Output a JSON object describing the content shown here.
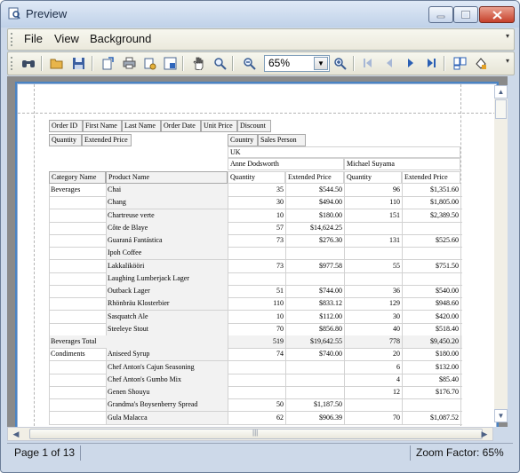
{
  "window": {
    "title": "Preview"
  },
  "menu": {
    "file": "File",
    "view": "View",
    "background": "Background"
  },
  "toolbar": {
    "zoom_value": "65%"
  },
  "statusbar": {
    "page": "Page 1 of 13",
    "zoom": "Zoom Factor: 65%"
  },
  "report": {
    "header_fields": [
      "Order ID",
      "First Name",
      "Last Name",
      "Order Date",
      "Unit Price",
      "Discount"
    ],
    "data_fields": [
      "Quantity",
      "Extended Price"
    ],
    "column_fields": [
      "Country",
      "Sales Person"
    ],
    "country": "UK",
    "sales_persons": [
      "Anne Dodsworth",
      "Michael Suyama"
    ],
    "row_fields": [
      "Category Name",
      "Product Name"
    ],
    "measure_headers": [
      "Quantity",
      "Extended Price",
      "Quantity",
      "Extended Price"
    ],
    "groups": [
      {
        "category": "Beverages",
        "rows": [
          {
            "product": "Chai",
            "q1": "35",
            "p1": "$544.50",
            "q2": "96",
            "p2": "$1,351.60"
          },
          {
            "product": "Chang",
            "q1": "30",
            "p1": "$494.00",
            "q2": "110",
            "p2": "$1,805.00"
          },
          {
            "product": "Chartreuse verte",
            "q1": "10",
            "p1": "$180.00",
            "q2": "151",
            "p2": "$2,389.50"
          },
          {
            "product": "Côte de Blaye",
            "q1": "57",
            "p1": "$14,624.25",
            "q2": "",
            "p2": ""
          },
          {
            "product": "Guaraná Fantástica",
            "q1": "73",
            "p1": "$276.30",
            "q2": "131",
            "p2": "$525.60"
          },
          {
            "product": "Ipoh Coffee",
            "q1": "",
            "p1": "",
            "q2": "",
            "p2": ""
          },
          {
            "product": "Lakkalikööri",
            "q1": "73",
            "p1": "$977.58",
            "q2": "55",
            "p2": "$751.50"
          },
          {
            "product": "Laughing Lumberjack Lager",
            "q1": "",
            "p1": "",
            "q2": "",
            "p2": ""
          },
          {
            "product": "Outback Lager",
            "q1": "51",
            "p1": "$744.00",
            "q2": "36",
            "p2": "$540.00"
          },
          {
            "product": "Rhönbräu Klosterbier",
            "q1": "110",
            "p1": "$833.12",
            "q2": "129",
            "p2": "$948.60"
          },
          {
            "product": "Sasquatch Ale",
            "q1": "10",
            "p1": "$112.00",
            "q2": "30",
            "p2": "$420.00"
          },
          {
            "product": "Steeleye Stout",
            "q1": "70",
            "p1": "$856.80",
            "q2": "40",
            "p2": "$518.40"
          }
        ],
        "total_label": "Beverages Total",
        "total": {
          "q1": "519",
          "p1": "$19,642.55",
          "q2": "778",
          "p2": "$9,450.20"
        }
      },
      {
        "category": "Condiments",
        "rows": [
          {
            "product": "Aniseed Syrup",
            "q1": "74",
            "p1": "$740.00",
            "q2": "20",
            "p2": "$180.00"
          },
          {
            "product": "Chef Anton's Cajun Seasoning",
            "q1": "",
            "p1": "",
            "q2": "6",
            "p2": "$132.00"
          },
          {
            "product": "Chef Anton's Gumbo Mix",
            "q1": "",
            "p1": "",
            "q2": "4",
            "p2": "$85.40"
          },
          {
            "product": "Genen Shouyu",
            "q1": "",
            "p1": "",
            "q2": "12",
            "p2": "$176.70"
          },
          {
            "product": "Grandma's Boysenberry Spread",
            "q1": "50",
            "p1": "$1,187.50",
            "q2": "",
            "p2": ""
          },
          {
            "product": "Gula Malacca",
            "q1": "62",
            "p1": "$906.39",
            "q2": "70",
            "p2": "$1,087.52"
          }
        ]
      }
    ]
  }
}
